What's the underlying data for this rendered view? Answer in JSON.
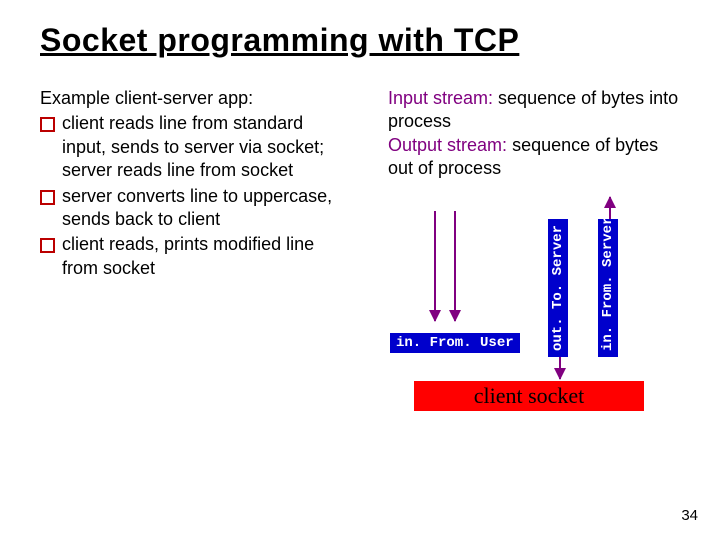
{
  "title": "Socket programming with TCP",
  "left": {
    "heading": "Example client-server app:",
    "bullets": [
      "client reads line from standard input, sends to server via socket; server reads line from socket",
      "server converts line to uppercase, sends back to client",
      "client reads, prints  modified line from socket"
    ]
  },
  "right": {
    "input_term": "Input stream:",
    "input_def": " sequence of bytes into process",
    "output_term": "Output stream:",
    "output_def": " sequence of bytes out of process"
  },
  "diagram": {
    "in_from_user": "in. From. User",
    "out_to_server": "out. To. Server",
    "in_from_server": "in. From. Server",
    "client_socket": "client socket"
  },
  "page_number": "34"
}
